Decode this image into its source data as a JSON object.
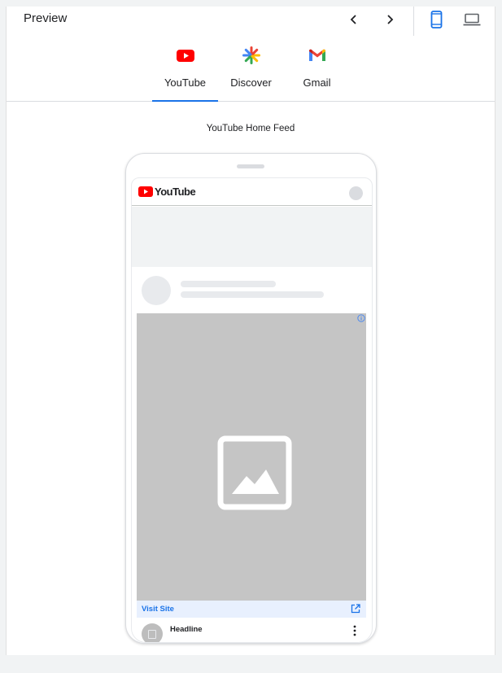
{
  "header": {
    "title": "Preview",
    "prev_icon": "chevron-left-icon",
    "next_icon": "chevron-right-icon",
    "mobile_icon": "smartphone-icon",
    "desktop_icon": "laptop-icon",
    "accent_color": "#1a73e8"
  },
  "tabs": [
    {
      "label": "YouTube",
      "icon": "youtube-icon",
      "selected": true
    },
    {
      "label": "Discover",
      "icon": "discover-icon",
      "selected": false
    },
    {
      "label": "Gmail",
      "icon": "gmail-icon",
      "selected": false
    }
  ],
  "preview": {
    "section_title": "YouTube Home Feed",
    "app_logo_text": "YouTube",
    "visit_site_label": "Visit Site",
    "headline": "Headline",
    "media_color": "#c5c5c5"
  }
}
